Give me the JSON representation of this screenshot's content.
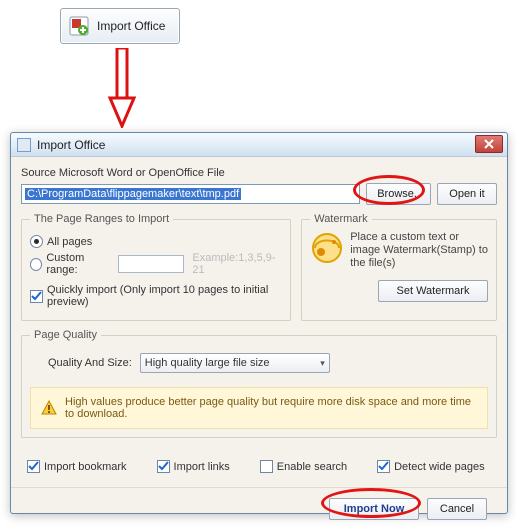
{
  "topButton": {
    "label": "Import Office"
  },
  "dialog": {
    "title": "Import Office",
    "sourceLabel": "Source Microsoft Word or OpenOffice File",
    "path": "C:\\ProgramData\\flippagemaker\\text\\tmp.pdf",
    "browse": "Browse..",
    "openIt": "Open it",
    "ranges": {
      "legend": "The Page Ranges to Import",
      "allPages": "All pages",
      "customRange": "Custom range:",
      "example": "Example:1,3,5,9-21",
      "quickImport": "Quickly import (Only import 10 pages to initial preview)"
    },
    "watermark": {
      "legend": "Watermark",
      "desc": "Place a custom text or image Watermark(Stamp) to the file(s)",
      "setBtn": "Set Watermark"
    },
    "quality": {
      "legend": "Page Quality",
      "label": "Quality And Size:",
      "selected": "High quality large file size",
      "hint": "High values produce better page quality but require more disk space and more time to download."
    },
    "checks": {
      "importBookmark": "Import bookmark",
      "importLinks": "Import links",
      "enableSearch": "Enable search",
      "detectWide": "Detect wide pages"
    },
    "footer": {
      "importNow": "Import Now",
      "cancel": "Cancel"
    }
  }
}
